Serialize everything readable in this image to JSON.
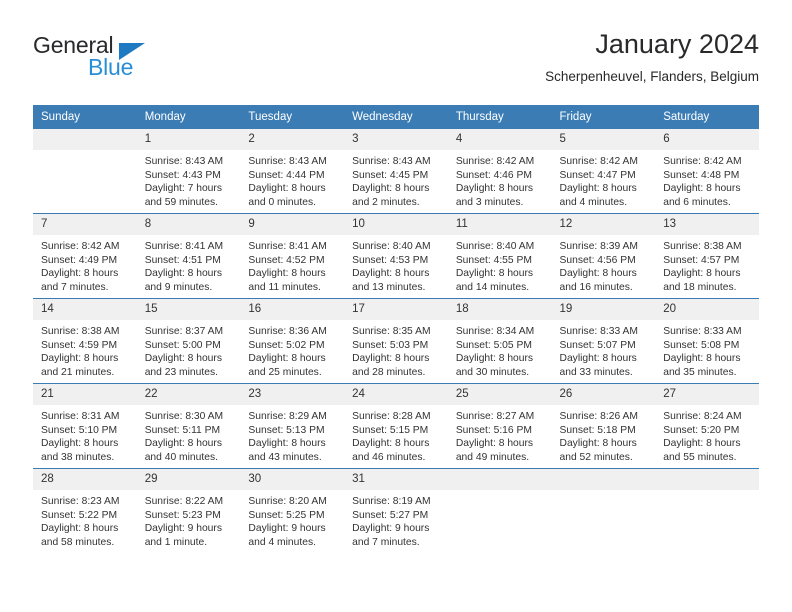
{
  "brand": {
    "name_top": "General",
    "name_bottom": "Blue",
    "accent_color": "#2a8ed6",
    "triangle_color": "#1f7bc1"
  },
  "header": {
    "title": "January 2024",
    "subtitle": "Scherpenheuvel, Flanders, Belgium",
    "header_bg": "#3b7cb4",
    "daynum_bg": "#f0f0f0"
  },
  "weekday_headers": [
    "Sunday",
    "Monday",
    "Tuesday",
    "Wednesday",
    "Thursday",
    "Friday",
    "Saturday"
  ],
  "weeks": [
    [
      {
        "day": "",
        "sunrise": "",
        "sunset": "",
        "daylight_line1": "",
        "daylight_line2": "",
        "empty": true
      },
      {
        "day": "1",
        "sunrise": "Sunrise: 8:43 AM",
        "sunset": "Sunset: 4:43 PM",
        "daylight_line1": "Daylight: 7 hours",
        "daylight_line2": "and 59 minutes."
      },
      {
        "day": "2",
        "sunrise": "Sunrise: 8:43 AM",
        "sunset": "Sunset: 4:44 PM",
        "daylight_line1": "Daylight: 8 hours",
        "daylight_line2": "and 0 minutes."
      },
      {
        "day": "3",
        "sunrise": "Sunrise: 8:43 AM",
        "sunset": "Sunset: 4:45 PM",
        "daylight_line1": "Daylight: 8 hours",
        "daylight_line2": "and 2 minutes."
      },
      {
        "day": "4",
        "sunrise": "Sunrise: 8:42 AM",
        "sunset": "Sunset: 4:46 PM",
        "daylight_line1": "Daylight: 8 hours",
        "daylight_line2": "and 3 minutes."
      },
      {
        "day": "5",
        "sunrise": "Sunrise: 8:42 AM",
        "sunset": "Sunset: 4:47 PM",
        "daylight_line1": "Daylight: 8 hours",
        "daylight_line2": "and 4 minutes."
      },
      {
        "day": "6",
        "sunrise": "Sunrise: 8:42 AM",
        "sunset": "Sunset: 4:48 PM",
        "daylight_line1": "Daylight: 8 hours",
        "daylight_line2": "and 6 minutes."
      }
    ],
    [
      {
        "day": "7",
        "sunrise": "Sunrise: 8:42 AM",
        "sunset": "Sunset: 4:49 PM",
        "daylight_line1": "Daylight: 8 hours",
        "daylight_line2": "and 7 minutes."
      },
      {
        "day": "8",
        "sunrise": "Sunrise: 8:41 AM",
        "sunset": "Sunset: 4:51 PM",
        "daylight_line1": "Daylight: 8 hours",
        "daylight_line2": "and 9 minutes."
      },
      {
        "day": "9",
        "sunrise": "Sunrise: 8:41 AM",
        "sunset": "Sunset: 4:52 PM",
        "daylight_line1": "Daylight: 8 hours",
        "daylight_line2": "and 11 minutes."
      },
      {
        "day": "10",
        "sunrise": "Sunrise: 8:40 AM",
        "sunset": "Sunset: 4:53 PM",
        "daylight_line1": "Daylight: 8 hours",
        "daylight_line2": "and 13 minutes."
      },
      {
        "day": "11",
        "sunrise": "Sunrise: 8:40 AM",
        "sunset": "Sunset: 4:55 PM",
        "daylight_line1": "Daylight: 8 hours",
        "daylight_line2": "and 14 minutes."
      },
      {
        "day": "12",
        "sunrise": "Sunrise: 8:39 AM",
        "sunset": "Sunset: 4:56 PM",
        "daylight_line1": "Daylight: 8 hours",
        "daylight_line2": "and 16 minutes."
      },
      {
        "day": "13",
        "sunrise": "Sunrise: 8:38 AM",
        "sunset": "Sunset: 4:57 PM",
        "daylight_line1": "Daylight: 8 hours",
        "daylight_line2": "and 18 minutes."
      }
    ],
    [
      {
        "day": "14",
        "sunrise": "Sunrise: 8:38 AM",
        "sunset": "Sunset: 4:59 PM",
        "daylight_line1": "Daylight: 8 hours",
        "daylight_line2": "and 21 minutes."
      },
      {
        "day": "15",
        "sunrise": "Sunrise: 8:37 AM",
        "sunset": "Sunset: 5:00 PM",
        "daylight_line1": "Daylight: 8 hours",
        "daylight_line2": "and 23 minutes."
      },
      {
        "day": "16",
        "sunrise": "Sunrise: 8:36 AM",
        "sunset": "Sunset: 5:02 PM",
        "daylight_line1": "Daylight: 8 hours",
        "daylight_line2": "and 25 minutes."
      },
      {
        "day": "17",
        "sunrise": "Sunrise: 8:35 AM",
        "sunset": "Sunset: 5:03 PM",
        "daylight_line1": "Daylight: 8 hours",
        "daylight_line2": "and 28 minutes."
      },
      {
        "day": "18",
        "sunrise": "Sunrise: 8:34 AM",
        "sunset": "Sunset: 5:05 PM",
        "daylight_line1": "Daylight: 8 hours",
        "daylight_line2": "and 30 minutes."
      },
      {
        "day": "19",
        "sunrise": "Sunrise: 8:33 AM",
        "sunset": "Sunset: 5:07 PM",
        "daylight_line1": "Daylight: 8 hours",
        "daylight_line2": "and 33 minutes."
      },
      {
        "day": "20",
        "sunrise": "Sunrise: 8:33 AM",
        "sunset": "Sunset: 5:08 PM",
        "daylight_line1": "Daylight: 8 hours",
        "daylight_line2": "and 35 minutes."
      }
    ],
    [
      {
        "day": "21",
        "sunrise": "Sunrise: 8:31 AM",
        "sunset": "Sunset: 5:10 PM",
        "daylight_line1": "Daylight: 8 hours",
        "daylight_line2": "and 38 minutes."
      },
      {
        "day": "22",
        "sunrise": "Sunrise: 8:30 AM",
        "sunset": "Sunset: 5:11 PM",
        "daylight_line1": "Daylight: 8 hours",
        "daylight_line2": "and 40 minutes."
      },
      {
        "day": "23",
        "sunrise": "Sunrise: 8:29 AM",
        "sunset": "Sunset: 5:13 PM",
        "daylight_line1": "Daylight: 8 hours",
        "daylight_line2": "and 43 minutes."
      },
      {
        "day": "24",
        "sunrise": "Sunrise: 8:28 AM",
        "sunset": "Sunset: 5:15 PM",
        "daylight_line1": "Daylight: 8 hours",
        "daylight_line2": "and 46 minutes."
      },
      {
        "day": "25",
        "sunrise": "Sunrise: 8:27 AM",
        "sunset": "Sunset: 5:16 PM",
        "daylight_line1": "Daylight: 8 hours",
        "daylight_line2": "and 49 minutes."
      },
      {
        "day": "26",
        "sunrise": "Sunrise: 8:26 AM",
        "sunset": "Sunset: 5:18 PM",
        "daylight_line1": "Daylight: 8 hours",
        "daylight_line2": "and 52 minutes."
      },
      {
        "day": "27",
        "sunrise": "Sunrise: 8:24 AM",
        "sunset": "Sunset: 5:20 PM",
        "daylight_line1": "Daylight: 8 hours",
        "daylight_line2": "and 55 minutes."
      }
    ],
    [
      {
        "day": "28",
        "sunrise": "Sunrise: 8:23 AM",
        "sunset": "Sunset: 5:22 PM",
        "daylight_line1": "Daylight: 8 hours",
        "daylight_line2": "and 58 minutes."
      },
      {
        "day": "29",
        "sunrise": "Sunrise: 8:22 AM",
        "sunset": "Sunset: 5:23 PM",
        "daylight_line1": "Daylight: 9 hours",
        "daylight_line2": "and 1 minute."
      },
      {
        "day": "30",
        "sunrise": "Sunrise: 8:20 AM",
        "sunset": "Sunset: 5:25 PM",
        "daylight_line1": "Daylight: 9 hours",
        "daylight_line2": "and 4 minutes."
      },
      {
        "day": "31",
        "sunrise": "Sunrise: 8:19 AM",
        "sunset": "Sunset: 5:27 PM",
        "daylight_line1": "Daylight: 9 hours",
        "daylight_line2": "and 7 minutes."
      },
      {
        "day": "",
        "sunrise": "",
        "sunset": "",
        "daylight_line1": "",
        "daylight_line2": "",
        "empty": true
      },
      {
        "day": "",
        "sunrise": "",
        "sunset": "",
        "daylight_line1": "",
        "daylight_line2": "",
        "empty": true
      },
      {
        "day": "",
        "sunrise": "",
        "sunset": "",
        "daylight_line1": "",
        "daylight_line2": "",
        "empty": true
      }
    ]
  ]
}
